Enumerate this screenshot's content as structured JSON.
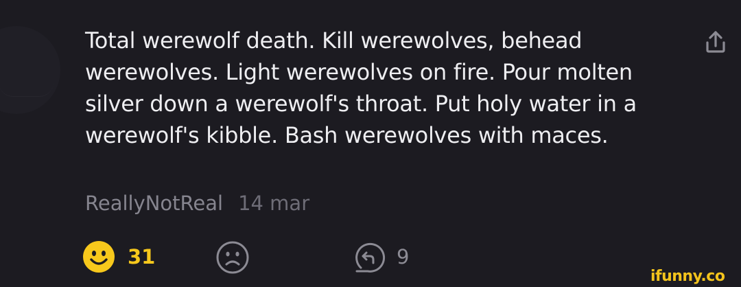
{
  "comment": {
    "text": "Total werewolf death. Kill werewolves, behead werewolves. Light werewolves on fire. Pour molten silver down a werewolf's throat. Put holy water in a werewolf's kibble. Bash werewolves with maces.",
    "author": "ReallyNotReal",
    "date": "14 mar"
  },
  "actions": {
    "smile_icon": "smile-face-icon",
    "smile_count": "31",
    "sad_icon": "sad-face-icon",
    "reply_icon": "reply-icon",
    "reply_count": "9",
    "share_icon": "share-icon"
  },
  "colors": {
    "background": "#1c1b21",
    "text": "#eeeef1",
    "meta": "#86858f",
    "accent_yellow": "#f7c81c",
    "icon_gray": "#8c8b94"
  },
  "watermark": {
    "text": "ifunny.co"
  }
}
